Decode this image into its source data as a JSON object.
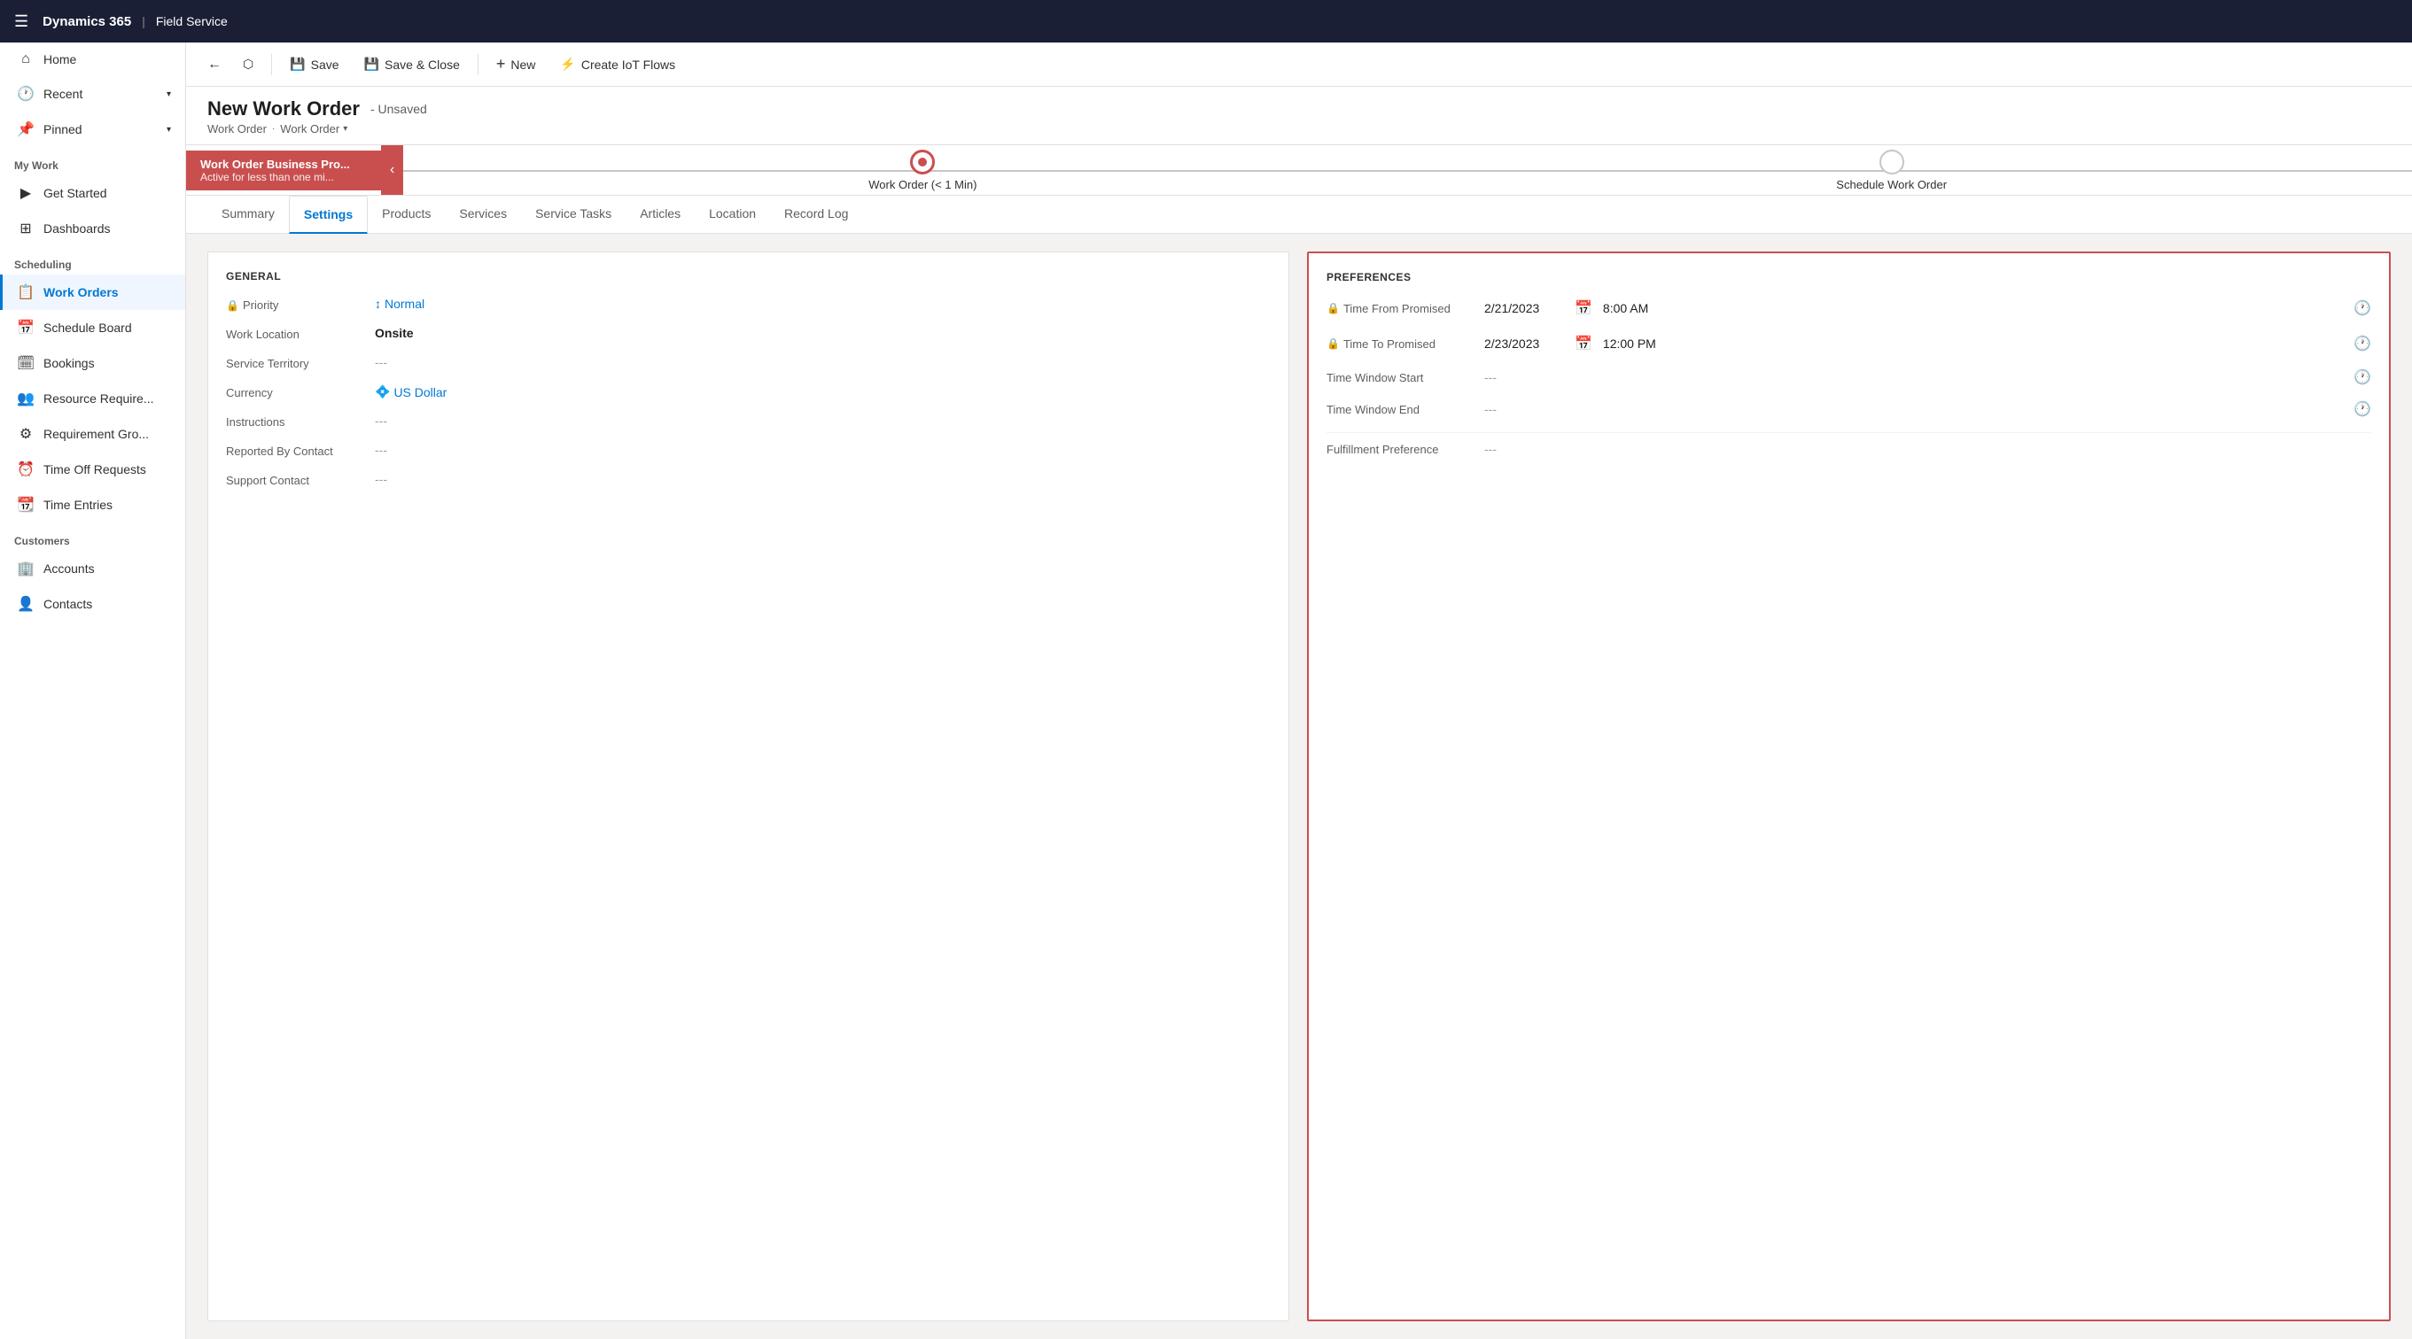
{
  "topNav": {
    "title": "Dynamics 365",
    "divider": "|",
    "appName": "Field Service"
  },
  "toolbar": {
    "back": "←",
    "popout": "⬡",
    "save": "Save",
    "saveClose": "Save & Close",
    "new": "New",
    "createIoT": "Create IoT Flows"
  },
  "pageHeader": {
    "title": "New Work Order",
    "statusLabel": "- Unsaved",
    "breadcrumb1": "Work Order",
    "breadcrumb2": "Work Order"
  },
  "stageBar": {
    "activeStageName": "Work Order Business Pro...",
    "activeStageSubtitle": "Active for less than one mi...",
    "stage1Label": "Work Order (< 1 Min)",
    "stage2Label": "Schedule Work Order"
  },
  "tabs": {
    "items": [
      {
        "label": "Summary",
        "active": false
      },
      {
        "label": "Settings",
        "active": true
      },
      {
        "label": "Products",
        "active": false
      },
      {
        "label": "Services",
        "active": false
      },
      {
        "label": "Service Tasks",
        "active": false
      },
      {
        "label": "Articles",
        "active": false
      },
      {
        "label": "Location",
        "active": false
      },
      {
        "label": "Record Log",
        "active": false
      }
    ]
  },
  "generalSection": {
    "title": "GENERAL",
    "fields": [
      {
        "label": "Priority",
        "value": "↓↑ Normal",
        "type": "link",
        "icon": "🔒"
      },
      {
        "label": "Work Location",
        "value": "Onsite",
        "type": "bold",
        "icon": ""
      },
      {
        "label": "Service Territory",
        "value": "---",
        "type": "empty",
        "icon": ""
      },
      {
        "label": "Currency",
        "value": "US Dollar",
        "type": "link",
        "icon": "",
        "currencyIcon": "💠"
      },
      {
        "label": "Instructions",
        "value": "---",
        "type": "empty",
        "icon": ""
      },
      {
        "label": "Reported By Contact",
        "value": "---",
        "type": "empty",
        "icon": ""
      },
      {
        "label": "Support Contact",
        "value": "---",
        "type": "empty",
        "icon": ""
      }
    ]
  },
  "preferencesSection": {
    "title": "PREFERENCES",
    "rows": [
      {
        "label": "Time From Promised",
        "date": "2/21/2023",
        "time": "8:00 AM",
        "hasIcons": true,
        "icon": "🔒"
      },
      {
        "label": "Time To Promised",
        "date": "2/23/2023",
        "time": "12:00 PM",
        "hasIcons": true,
        "icon": "🔒"
      },
      {
        "label": "Time Window Start",
        "date": "---",
        "time": "",
        "hasIcons": false,
        "icon": ""
      },
      {
        "label": "Time Window End",
        "date": "---",
        "time": "",
        "hasIcons": false,
        "icon": ""
      }
    ],
    "fulfillmentLabel": "Fulfillment Preference",
    "fulfillmentValue": "---"
  },
  "sidebar": {
    "items": [
      {
        "label": "Home",
        "icon": "⌂",
        "active": false,
        "section": ""
      },
      {
        "label": "Recent",
        "icon": "🕐",
        "active": false,
        "section": "",
        "hasChevron": true
      },
      {
        "label": "Pinned",
        "icon": "📌",
        "active": false,
        "section": "",
        "hasChevron": true
      },
      {
        "label": "My Work",
        "icon": "",
        "active": false,
        "section": "My Work",
        "isSectionTitle": true
      },
      {
        "label": "Get Started",
        "icon": "▶",
        "active": false,
        "section": "My Work"
      },
      {
        "label": "Dashboards",
        "icon": "⊞",
        "active": false,
        "section": "My Work"
      },
      {
        "label": "Scheduling",
        "icon": "",
        "active": false,
        "section": "Scheduling",
        "isSectionTitle": true
      },
      {
        "label": "Work Orders",
        "icon": "📋",
        "active": true,
        "section": "Scheduling"
      },
      {
        "label": "Schedule Board",
        "icon": "📅",
        "active": false,
        "section": "Scheduling"
      },
      {
        "label": "Bookings",
        "icon": "👤",
        "active": false,
        "section": "Scheduling"
      },
      {
        "label": "Resource Require...",
        "icon": "👥",
        "active": false,
        "section": "Scheduling"
      },
      {
        "label": "Requirement Gro...",
        "icon": "⚙",
        "active": false,
        "section": "Scheduling"
      },
      {
        "label": "Time Off Requests",
        "icon": "⏰",
        "active": false,
        "section": "Scheduling"
      },
      {
        "label": "Time Entries",
        "icon": "📆",
        "active": false,
        "section": "Scheduling"
      },
      {
        "label": "Customers",
        "icon": "",
        "active": false,
        "section": "Customers",
        "isSectionTitle": true
      },
      {
        "label": "Accounts",
        "icon": "🏢",
        "active": false,
        "section": "Customers"
      },
      {
        "label": "Contacts",
        "icon": "👤",
        "active": false,
        "section": "Customers"
      }
    ]
  }
}
